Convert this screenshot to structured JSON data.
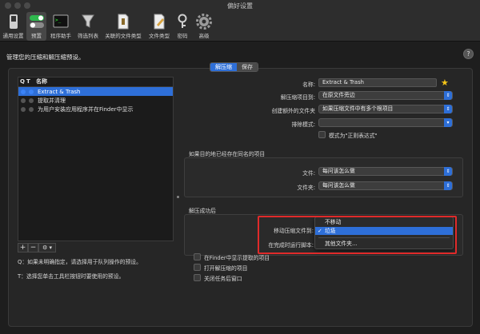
{
  "window": {
    "title": "偏好设置"
  },
  "toolbar": {
    "items": [
      {
        "label": "通用设置",
        "icon": "switch-icon"
      },
      {
        "label": "预置",
        "icon": "toggles-icon",
        "selected": true
      },
      {
        "label": "程序助手",
        "icon": "terminal-icon"
      },
      {
        "label": "筛选列表",
        "icon": "funnel-icon"
      },
      {
        "label": "关联的文件类型",
        "icon": "archive-doc-icon"
      },
      {
        "label": "文件类型",
        "icon": "doc-edit-icon"
      },
      {
        "label": "密码",
        "icon": "key-icon"
      },
      {
        "label": "高级",
        "icon": "gear-icon"
      }
    ]
  },
  "header": {
    "text": "管理您的压缩和解压缩预设。",
    "help": "?"
  },
  "tabs": {
    "extract": "解压缩",
    "save": "保存"
  },
  "presets": {
    "headers": {
      "q": "Q",
      "t": "T",
      "name": "名称"
    },
    "rows": [
      {
        "name": "Extract & Trash",
        "selected": true
      },
      {
        "name": "提取并清理"
      },
      {
        "name": "为用户安装应用程序并在Finder中显示"
      }
    ],
    "buttons": {
      "add": "+",
      "remove": "−",
      "action": "⚙ ▾"
    },
    "notes": [
      "Q：如果未明确指定，请选择用于队列操作的预设。",
      "T：选择您单击工具栏按钮时要使用的预设。"
    ]
  },
  "form": {
    "name_label": "名称:",
    "name_value": "Extract & Trash",
    "extract_to_label": "解压缩项目到:",
    "extract_to_value": "在原文件旁边",
    "create_folder_label": "创建额外的文件夹",
    "create_folder_value": "如果压缩文件中有多个根项目",
    "exclude_label": "排除模式:",
    "exclude_value": "",
    "regex_label": "模式为\"正则表达式\""
  },
  "conflict": {
    "title": "如果目的地已经存在同名的项目",
    "file_label": "文件:",
    "file_value": "每问该怎么做",
    "folder_label": "文件夹:",
    "folder_value": "每问该怎么做"
  },
  "success": {
    "title": "解压成功后",
    "move_label": "移动压缩文件到:",
    "run_label": "在完成时运行脚本:",
    "menu": {
      "items": [
        "不移动",
        "垃圾",
        "其他文件夹..."
      ],
      "checked": "✓"
    },
    "checks": [
      "在Finder中显示提取的项目",
      "打开解压缩的项目",
      "关闭任务后窗口"
    ]
  },
  "colors": {
    "accent": "#2e6fd8",
    "highlight_box": "#e02a2a",
    "star": "#f5c518"
  }
}
